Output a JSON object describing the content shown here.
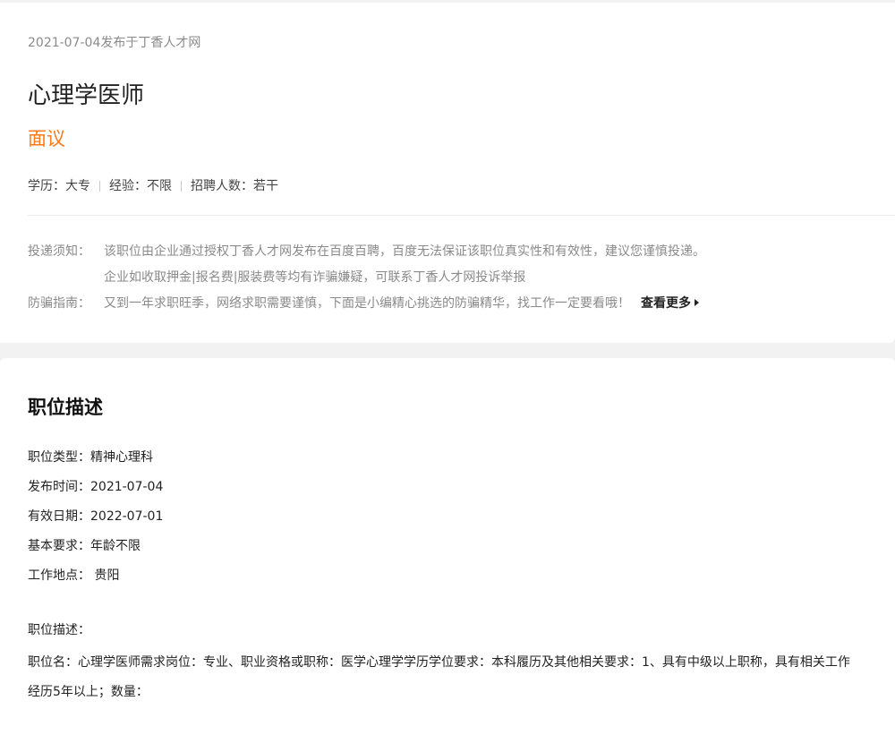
{
  "header": {
    "publish_info": "2021-07-04发布于丁香人才网",
    "job_title": "心理学医师",
    "salary": "面议",
    "requirements": [
      "学历：大专",
      "经验：不限",
      "招聘人数：若干"
    ]
  },
  "notice": {
    "delivery_label": "投递须知：",
    "delivery_line1": "该职位由企业通过授权丁香人才网发布在百度百聘，百度无法保证该职位真实性和有效性，建议您谨慎投递。",
    "delivery_line2": "企业如收取押金|报名费|服装费等均有诈骗嫌疑，可联系丁香人才网投诉举报",
    "fraud_label": "防骗指南：",
    "fraud_text": "又到一年求职旺季，网络求职需要谨慎，下面是小编精心挑选的防骗精华，找工作一定要看哦！",
    "more_label": "查看更多"
  },
  "description": {
    "section_title": "职位描述",
    "job_type": "职位类型：精神心理科",
    "publish_time": "发布时间：2021-07-04",
    "valid_date": "有效日期：2022-07-01",
    "basic_req": "基本要求：年龄不限",
    "location": "工作地点： 贵阳",
    "desc_label": "职位描述：",
    "desc_text": "职位名：心理学医师需求岗位：专业、职业资格或职称：医学心理学学历学位要求：本科履历及其他相关要求：1、具有中级以上职称，具有相关工作经历5年以上；数量："
  }
}
